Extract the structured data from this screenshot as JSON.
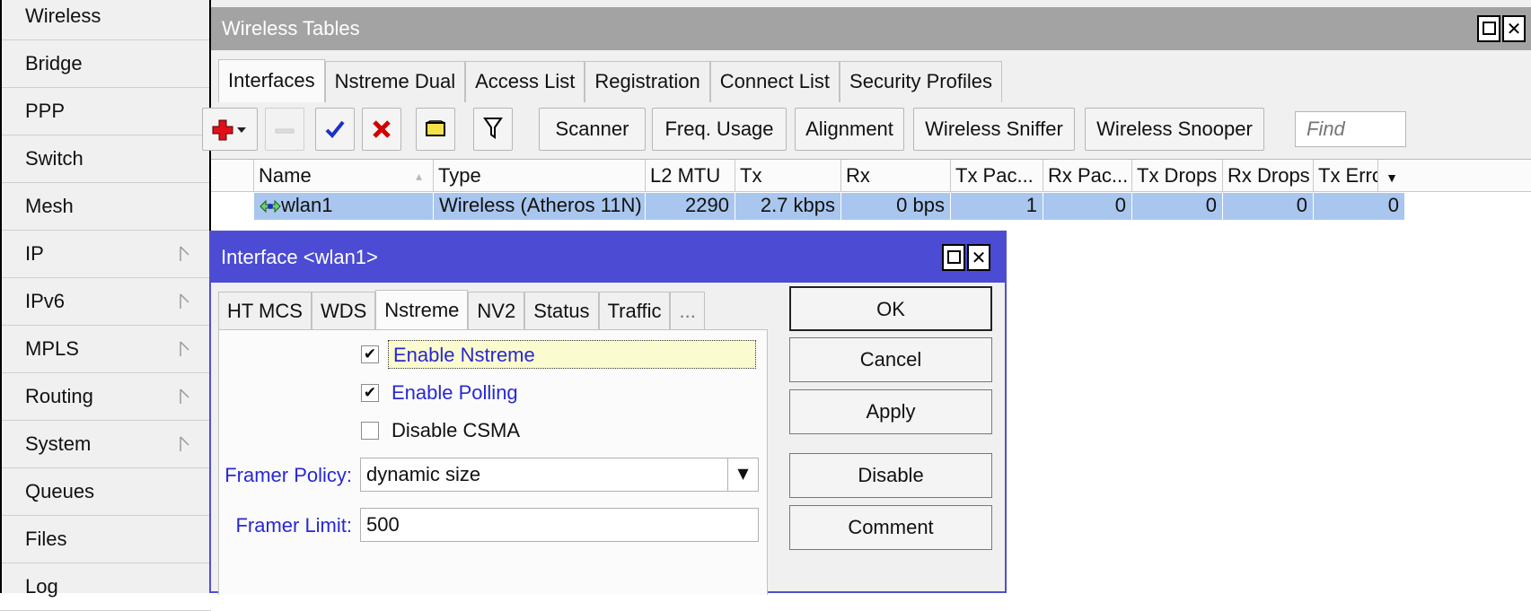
{
  "sidebar": {
    "items": [
      {
        "label": "Wireless",
        "submenu": false
      },
      {
        "label": "Bridge",
        "submenu": false
      },
      {
        "label": "PPP",
        "submenu": false
      },
      {
        "label": "Switch",
        "submenu": false
      },
      {
        "label": "Mesh",
        "submenu": false
      },
      {
        "label": "IP",
        "submenu": true
      },
      {
        "label": "IPv6",
        "submenu": true
      },
      {
        "label": "MPLS",
        "submenu": true
      },
      {
        "label": "Routing",
        "submenu": true
      },
      {
        "label": "System",
        "submenu": true
      },
      {
        "label": "Queues",
        "submenu": false
      },
      {
        "label": "Files",
        "submenu": false
      },
      {
        "label": "Log",
        "submenu": false
      }
    ]
  },
  "wireless_tables": {
    "title": "Wireless Tables",
    "tabs": [
      "Interfaces",
      "Nstreme Dual",
      "Access List",
      "Registration",
      "Connect List",
      "Security Profiles"
    ],
    "active_tab": "Interfaces",
    "toolbar": {
      "buttons": [
        "Scanner",
        "Freq. Usage",
        "Alignment",
        "Wireless Sniffer",
        "Wireless Snooper"
      ],
      "find_placeholder": "Find"
    },
    "table": {
      "columns": [
        "Name",
        "Type",
        "L2 MTU",
        "Tx",
        "Rx",
        "Tx Pac...",
        "Rx Pac...",
        "Tx Drops",
        "Rx Drops",
        "Tx Erro"
      ],
      "rows": [
        [
          "wlan1",
          "Wireless (Atheros 11N)",
          "2290",
          "2.7 kbps",
          "0 bps",
          "1",
          "0",
          "0",
          "0",
          "0"
        ]
      ]
    }
  },
  "interface_dialog": {
    "title": "Interface <wlan1>",
    "tabs": [
      "HT MCS",
      "WDS",
      "Nstreme",
      "NV2",
      "Status",
      "Traffic",
      "..."
    ],
    "active_tab": "Nstreme",
    "checkboxes": [
      {
        "label": "Enable Nstreme",
        "checked": true
      },
      {
        "label": "Enable Polling",
        "checked": true
      },
      {
        "label": "Disable CSMA",
        "checked": false
      }
    ],
    "framer_policy": {
      "label": "Framer Policy:",
      "value": "dynamic size"
    },
    "framer_limit": {
      "label": "Framer Limit:",
      "value": "500"
    },
    "buttons": [
      "OK",
      "Cancel",
      "Apply",
      "Disable",
      "Comment"
    ]
  },
  "colors": {
    "selected_row": "#a9c6ee",
    "dialog_titlebar": "#4b4bd3",
    "window_titlebar": "#a3a3a3",
    "field_label": "#2828d4"
  }
}
